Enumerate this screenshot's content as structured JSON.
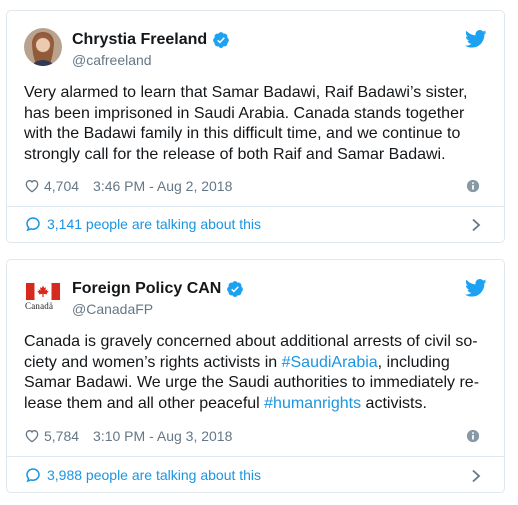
{
  "tweets": [
    {
      "name": "Chrystia Freeland",
      "handle": "@cafreeland",
      "text": "Very alarmed to learn that Samar Badawi, Raif Badawi’s sister, has been imprisoned in Saudi Arabia. Canada stands together with the Badawi family in this difficult time, and we continue to strongly call for the release of both Raif and Samar Badawi.",
      "likes": "4,704",
      "timestamp": "3:46 PM - Aug 2, 2018",
      "talking": "3,141 people are talking about this"
    },
    {
      "name": "Foreign Policy CAN",
      "handle": "@CanadaFP",
      "avatar_wordmark": "Canada",
      "text_parts": [
        "Canada is gravely concerned about additional arrests of civil so-ciety and women’s rights activists in ",
        "#SaudiArabia",
        ", including Samar Badawi. We urge the Saudi authorities to immediately re-lease them and all other peaceful ",
        "#humanrights",
        " activists."
      ],
      "likes": "5,784",
      "timestamp": "3:10 PM - Aug 3, 2018",
      "talking": "3,988 people are talking about this"
    }
  ],
  "colors": {
    "twitter_blue": "#1da1f2",
    "link_blue": "#1b95e0",
    "secondary_text": "#657786",
    "border": "#e1e8ed",
    "canada_red": "#d52b1e"
  },
  "icons": [
    "verified-badge-icon",
    "twitter-bird-icon",
    "heart-icon",
    "info-icon",
    "speech-bubble-icon",
    "chevron-right-icon"
  ]
}
